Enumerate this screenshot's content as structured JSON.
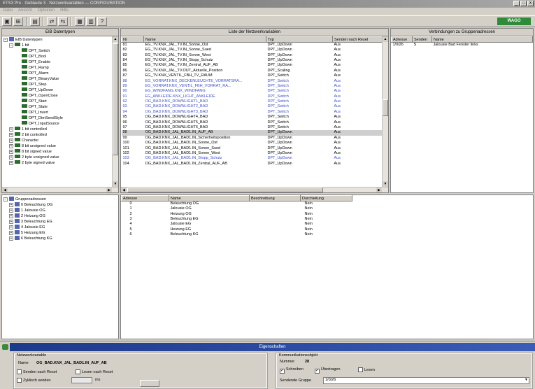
{
  "window": {
    "title": "ETS3 Pro · Gebäude 3 · Netzwerkvariablen — CONFIGURATION",
    "buttons": [
      "_",
      "□",
      "X"
    ]
  },
  "menu": [
    "Datei",
    "Ansicht",
    "Optionen",
    "Hilfe"
  ],
  "toolbar": {
    "help_label": "?"
  },
  "logo": {
    "text": "WAGO",
    "color": "#2f8a3a"
  },
  "eib_panel": {
    "title": "EIB Datentypen",
    "root": "EIB Datentypen",
    "group_1bit": "1 bit",
    "items": [
      "DPT_Switch",
      "DPT_Bool",
      "DPT_Enable",
      "DPT_Ramp",
      "DPT_Alarm",
      "DPT_BinaryValue",
      "DPT_Step",
      "DPT_UpDown",
      "DPT_OpenClose",
      "DPT_Start",
      "DPT_State",
      "DPT_Invert",
      "DPT_DimSendStyle",
      "DPT_InputSource"
    ],
    "groups": [
      "1 bit controlled",
      "2 bit controlled",
      "Character",
      "8 bit unsigned value",
      "8 bit signed value",
      "2 byte unsigned value",
      "2 byte signed value"
    ]
  },
  "netvars_panel": {
    "title": "Liste der Netzwerkvariablen",
    "columns": [
      "Nr",
      "Name",
      "Typ",
      "Senden nach Reset"
    ],
    "rows": [
      {
        "nr": "81",
        "name": "EG_TV.KNX_JAL_TV.IN_Sonne_Ost",
        "typ": "DPT_UpDown",
        "reset": "Aus",
        "style": ""
      },
      {
        "nr": "82",
        "name": "EG_TV.KNX_JAL_TV.IN_Sonne_Sued",
        "typ": "DPT_UpDown",
        "reset": "Aus",
        "style": ""
      },
      {
        "nr": "83",
        "name": "EG_TV.KNX_JAL_TV.IN_Sonne_West",
        "typ": "DPT_UpDown",
        "reset": "Aus",
        "style": ""
      },
      {
        "nr": "84",
        "name": "EG_TV.KNX_JAL_TV.IN_Stopp_Schutz",
        "typ": "DPT_UpDown",
        "reset": "Aus",
        "style": ""
      },
      {
        "nr": "85",
        "name": "EG_TV.KNX_JAL_TV.IN_Zentral_AUF_AB",
        "typ": "DPT_UpDown",
        "reset": "Aus",
        "style": ""
      },
      {
        "nr": "86",
        "name": "EG_TV.KNX_JAL_TV.OUT_Aktuelle_Position",
        "typ": "DPT_Scaling",
        "reset": "Aus",
        "style": ""
      },
      {
        "nr": "87",
        "name": "EG_TV.KNX_VENTIL_FBH_TV_RAUM",
        "typ": "DPT_Switch",
        "reset": "Aus",
        "style": ""
      },
      {
        "nr": "88",
        "name": "EG_VORRAT.KNX_DECKENLEUCHTE_VORRATSRA...",
        "typ": "DPT_Switch",
        "reset": "Aus",
        "style": "blue"
      },
      {
        "nr": "89",
        "name": "EG_VORRAT.KNX_VENTIL_FBH_VORRAT_RA...",
        "typ": "DPT_Switch",
        "reset": "Aus",
        "style": "blue"
      },
      {
        "nr": "90",
        "name": "EG_WINDFANG.KNX_WINDFANG",
        "typ": "DPT_Switch",
        "reset": "Aus",
        "style": "blue"
      },
      {
        "nr": "91",
        "name": "EG_ANKLEIDE.KNX_LICHT_ANKLEIDE",
        "typ": "DPT_Switch",
        "reset": "Aus",
        "style": "blue"
      },
      {
        "nr": "92",
        "name": "OG_BAD.KNX_DOWNLIGHT1_BAD",
        "typ": "DPT_Switch",
        "reset": "Aus",
        "style": "blue"
      },
      {
        "nr": "93",
        "name": "OG_BAD.KNX_DOWNLIGHT2_BAD",
        "typ": "DPT_Switch",
        "reset": "Aus",
        "style": "blue"
      },
      {
        "nr": "94",
        "name": "OG_BAD.KNX_DOWNLIGHT3_BAD",
        "typ": "DPT_Switch",
        "reset": "Aus",
        "style": "blue"
      },
      {
        "nr": "95",
        "name": "OG_BAD.KNX_DOWNLIGHT4_BAD",
        "typ": "DPT_Switch",
        "reset": "Aus",
        "style": ""
      },
      {
        "nr": "96",
        "name": "OG_BAD.KNX_DOWNLIGHT5_BAD",
        "typ": "DPT_Switch",
        "reset": "Aus",
        "style": ""
      },
      {
        "nr": "97",
        "name": "OG_BAD.KNX_DOWNLIGHT6_BAD",
        "typ": "DPT_Switch",
        "reset": "Aus",
        "style": ""
      },
      {
        "nr": "98",
        "name": "OG_BAD.KNX_JAL_BAD1.IN_AUF_AB",
        "typ": "DPT_UpDown",
        "reset": "Aus",
        "style": "sel"
      },
      {
        "nr": "99",
        "name": "OG_BAD.KNX_JAL_BAD1.IN_Sicherheitsposition",
        "typ": "DPT_UpDown",
        "reset": "Aus",
        "style": ""
      },
      {
        "nr": "100",
        "name": "OG_BAD.KNX_JAL_BAD1.IN_Sonne_Ost",
        "typ": "DPT_UpDown",
        "reset": "Aus",
        "style": ""
      },
      {
        "nr": "101",
        "name": "OG_BAD.KNX_JAL_BAD1.IN_Sonne_Sued",
        "typ": "DPT_UpDown",
        "reset": "Aus",
        "style": ""
      },
      {
        "nr": "102",
        "name": "OG_BAD.KNX_JAL_BAD1.IN_Sonne_West",
        "typ": "DPT_UpDown",
        "reset": "Aus",
        "style": ""
      },
      {
        "nr": "103",
        "name": "OG_BAD.KNX_JAL_BAD1.IN_Stopp_Schutz",
        "typ": "DPT_UpDown",
        "reset": "Aus",
        "style": "blue"
      },
      {
        "nr": "104",
        "name": "OG_BAD.KNX_JAL_BAD1.IN_Zentral_AUF_AB",
        "typ": "DPT_UpDown",
        "reset": "Aus",
        "style": ""
      }
    ]
  },
  "connections_panel": {
    "title": "Verbindungen zu Gruppenadressen",
    "columns": [
      "Adresse",
      "Senden",
      "Name"
    ],
    "rows": [
      {
        "adresse": "1/0/26",
        "senden": "S",
        "name": "Jalousie Bad Fenster links"
      }
    ]
  },
  "groups_panel": {
    "root": "Gruppenadressen",
    "items": [
      "0 Beleuchtung OG",
      "1 Jalousie OG",
      "2 Heizung OG",
      "3 Beleuchtung EG",
      "4 Jalousie EG",
      "5 Heizung EG",
      "6 Beleuchtung KG"
    ]
  },
  "address_table": {
    "columns": [
      "Adresse",
      "Name",
      "Beschreibung",
      "Durchleitung"
    ],
    "rows": [
      {
        "adresse": "0",
        "name": "Beleuchtung OG",
        "beschreibung": "",
        "durch": "Nein"
      },
      {
        "adresse": "1",
        "name": "Jalousie OG",
        "beschreibung": "",
        "durch": "Nein"
      },
      {
        "adresse": "2",
        "name": "Heizung OG",
        "beschreibung": "",
        "durch": "Nein"
      },
      {
        "adresse": "3",
        "name": "Beleuchtung EG",
        "beschreibung": "",
        "durch": "Nein"
      },
      {
        "adresse": "4",
        "name": "Jalousie EG",
        "beschreibung": "",
        "durch": "Nein"
      },
      {
        "adresse": "5",
        "name": "Heizung EG",
        "beschreibung": "",
        "durch": "Nein"
      },
      {
        "adresse": "6",
        "name": "Beleuchtung KG",
        "beschreibung": "",
        "durch": "Nein"
      }
    ]
  },
  "properties": {
    "title": "Eigenschaften",
    "netvar_section": "Netzwerkvariable",
    "name_label": "Name",
    "name_value": "OG_BAD.KNX_JAL_BAD1.IN_AUF_AB",
    "send_after_reset": "Senden nach Reset",
    "read_after_reset": "Lesen nach Reset",
    "cyclic_send": "Zyklisch senden",
    "cyclic_unit": "ms",
    "comm_section": "Kommunikationsobjekt",
    "number_label": "Nummer",
    "number_value": "28",
    "flag_write": "Schreiben",
    "flag_transmit": "Übertragen",
    "flag_read": "Lesen",
    "send_group_label": "Sendende Gruppe",
    "send_group_value": "1/0/26"
  }
}
